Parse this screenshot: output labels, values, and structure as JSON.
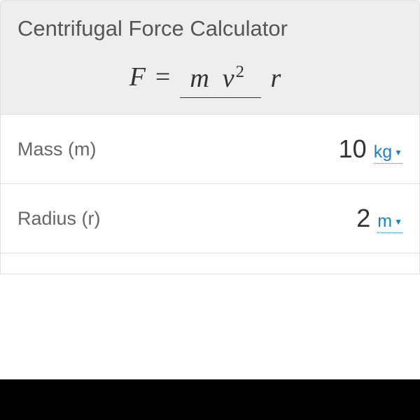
{
  "title": "Centrifugal Force Calculator",
  "formula": {
    "lhs": "F",
    "eq": "=",
    "num_m": "m",
    "num_v": "v",
    "num_exp": "2",
    "den": "r"
  },
  "rows": [
    {
      "label": "Mass (m)",
      "value": "10",
      "unit": "kg"
    },
    {
      "label": "Radius (r)",
      "value": "2",
      "unit": "m"
    }
  ],
  "colors": {
    "link": "#1a82c7",
    "header_bg": "#eeeeee"
  }
}
